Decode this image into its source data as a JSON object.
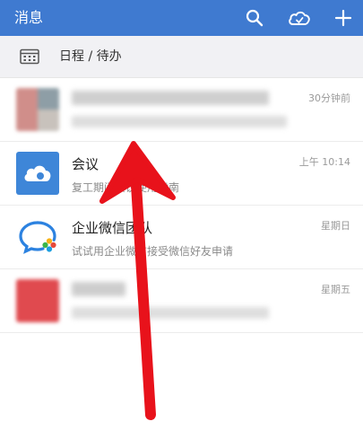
{
  "header": {
    "title": "消息"
  },
  "schedule": {
    "label": "日程 / 待办"
  },
  "chats": [
    {
      "name": "",
      "preview": "",
      "time": "30分钟前"
    },
    {
      "name": "会议",
      "preview": "复工期间会议使用指南",
      "time": "上午 10:14"
    },
    {
      "name": "企业微信团队",
      "preview": "试试用企业微信接受微信好友申请",
      "time": "星期日"
    },
    {
      "name": "",
      "preview": "",
      "time": "星期五"
    }
  ],
  "colors": {
    "header_bg": "#3f7ad0",
    "meeting_avatar_bg": "#3e86d8",
    "annotation_arrow": "#e8121b"
  },
  "icons": {
    "search": "search-icon",
    "cloud": "cloud-icon",
    "add": "plus-icon",
    "calendar": "calendar-icon",
    "meeting": "cloud-meeting-icon",
    "wework": "wework-logo-icon"
  }
}
